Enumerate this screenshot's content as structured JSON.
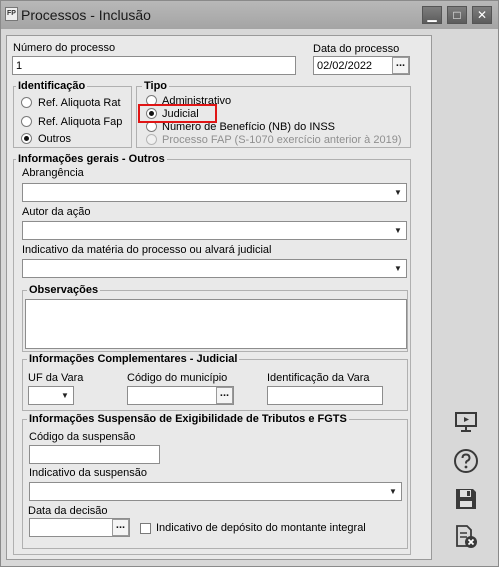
{
  "window": {
    "app_icon_text": "FP",
    "title": "Processos - Inclusão",
    "buttons": {
      "minimize": "▁",
      "maximize": "□",
      "close": "✕"
    }
  },
  "header": {
    "numero_label": "Número do processo",
    "numero_value": "1",
    "data_label": "Data do processo",
    "data_value": "02/02/2022",
    "data_button": "..."
  },
  "identificacao": {
    "title": "Identificação",
    "options": [
      {
        "label": "Ref. Aliquota Rat",
        "checked": false
      },
      {
        "label": "Ref. Aliquota Fap",
        "checked": false
      },
      {
        "label": "Outros",
        "checked": true
      }
    ]
  },
  "tipo": {
    "title": "Tipo",
    "options": [
      {
        "label": "Administrativo",
        "checked": false
      },
      {
        "label": "Judicial",
        "checked": true
      },
      {
        "label": "Número de Benefício (NB) do INSS",
        "checked": false
      },
      {
        "label": "Processo FAP (S-1070 exercício anterior à 2019)",
        "checked": false
      }
    ]
  },
  "gerais": {
    "title": "Informações gerais - Outros",
    "abrangencia_label": "Abrangência",
    "autor_label": "Autor da ação",
    "indicativo_label": "Indicativo da matéria do processo ou alvará judicial"
  },
  "observacoes": {
    "title": "Observações"
  },
  "complementares": {
    "title": "Informações Complementares - Judicial",
    "uf_label": "UF da Vara",
    "municipio_label": "Código do município",
    "municipio_button": "...",
    "vara_label": "Identificação da Vara"
  },
  "suspensao": {
    "title": "Informações Suspensão de Exigibilidade de Tributos e FGTS",
    "codigo_label": "Código da suspensão",
    "indicativo_label": "Indicativo da suspensão",
    "data_decisao_label": "Data da decisão",
    "data_button": "...",
    "deposito_label": "Indicativo de depósito do montante integral"
  },
  "side_toolbar": {
    "icons": [
      "monitor-icon",
      "help-icon",
      "save-icon",
      "cancel-doc-icon"
    ]
  },
  "colors": {
    "highlight": "#e01515",
    "window_bg": "#d8d8d8",
    "panel_bg": "#e9e9e9",
    "titlebar": "#a8a8a8"
  }
}
